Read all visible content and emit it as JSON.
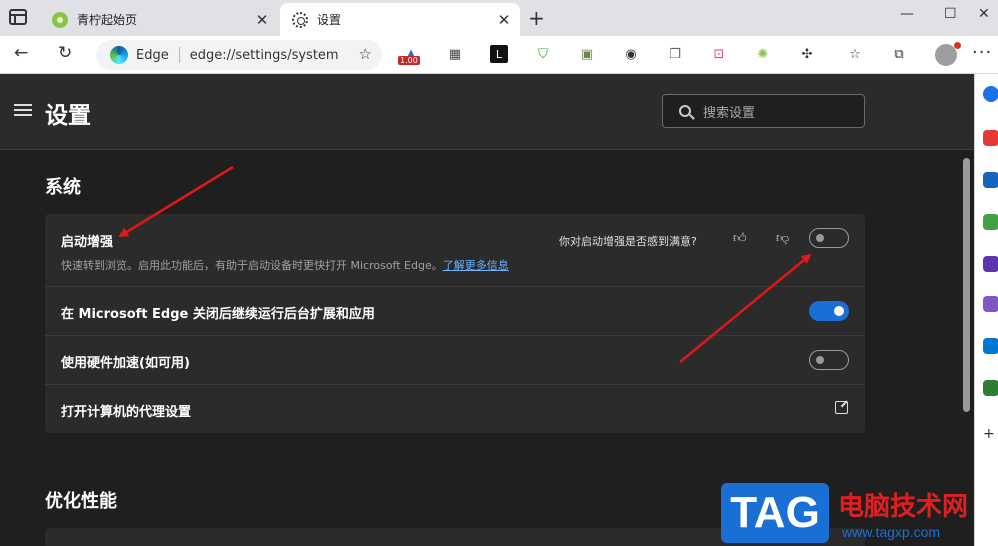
{
  "tabs": [
    {
      "title": "青柠起始页",
      "close": "✕"
    },
    {
      "title": "设置",
      "close": "✕"
    }
  ],
  "new_tab": "+",
  "window_controls": {
    "minimize": "—",
    "maximize": "☐",
    "close": "✕"
  },
  "toolbar": {
    "back": "←",
    "refresh": "↻",
    "brand": "Edge",
    "url": "edge://settings/system",
    "extension_badge": "1.00",
    "more": "···"
  },
  "header": {
    "title": "设置",
    "search_placeholder": "搜索设置"
  },
  "system_section": {
    "title": "系统",
    "startup_boost": {
      "label": "启动增强",
      "description": "快速转到浏览。启用此功能后，有助于启动设备时更快打开 Microsoft Edge。",
      "learn_more": "了解更多信息",
      "feedback_question": "你对启动增强是否感到满意?",
      "enabled": false
    },
    "background_apps": {
      "label": "在 Microsoft Edge 关闭后继续运行后台扩展和应用",
      "enabled": true
    },
    "hardware_accel": {
      "label": "使用硬件加速(如可用)",
      "enabled": false
    },
    "proxy": {
      "label": "打开计算机的代理设置"
    }
  },
  "performance_section": {
    "title": "优化性能"
  },
  "watermark": {
    "tag": "TAG",
    "site_name": "电脑技术网",
    "url": "www.tagxp.com"
  },
  "colors": {
    "accent": "#1a6fd4",
    "annotation_arrow": "#e01818",
    "page_bg": "#1f1f1f",
    "card_bg": "#2b2b2b"
  }
}
